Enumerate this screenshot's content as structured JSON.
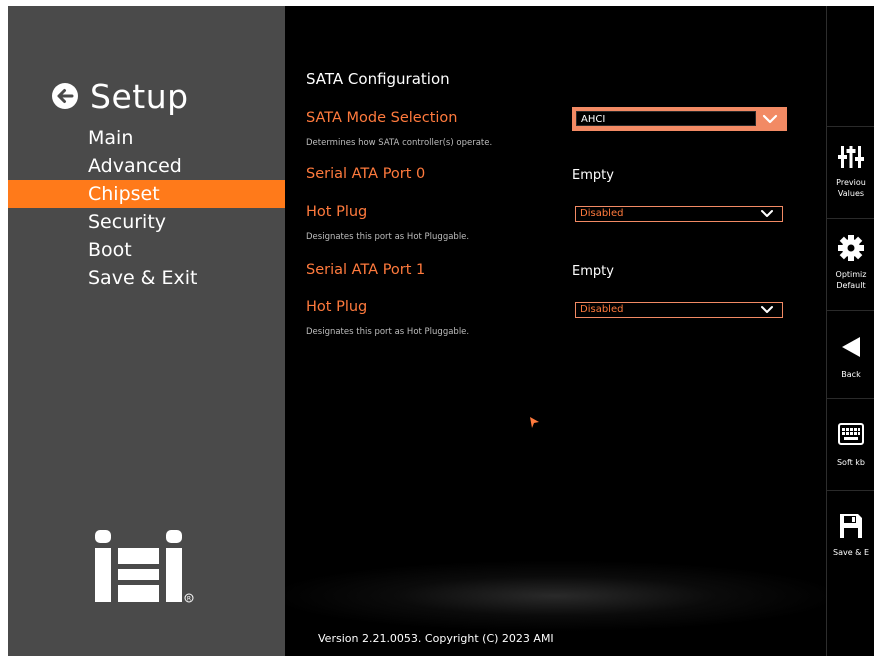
{
  "left_panel": {
    "title": "Setup",
    "menu": [
      {
        "label": "Main"
      },
      {
        "label": "Advanced"
      },
      {
        "label": "Chipset"
      },
      {
        "label": "Security"
      },
      {
        "label": "Boot"
      },
      {
        "label": "Save & Exit"
      }
    ],
    "active_index": 2,
    "logo_text": "iEi"
  },
  "main": {
    "section_title": "SATA Configuration",
    "sata_mode": {
      "label": "SATA Mode Selection",
      "value": "AHCI",
      "help": "Determines how SATA controller(s) operate."
    },
    "port0": {
      "label": "Serial ATA Port 0",
      "value": "Empty"
    },
    "hot_plug_0": {
      "label": "Hot Plug",
      "value": "Disabled",
      "help": "Designates this port as Hot Pluggable."
    },
    "port1": {
      "label": "Serial ATA Port 1",
      "value": "Empty"
    },
    "hot_plug_1": {
      "label": "Hot Plug",
      "value": "Disabled",
      "help": "Designates this port as Hot Pluggable."
    },
    "footer": "Version 2.21.0053. Copyright (C) 2023 AMI"
  },
  "right_panel": {
    "buttons": [
      {
        "label_line1": "Previou",
        "label_line2": "Values",
        "icon": "sliders-icon"
      },
      {
        "label_line1": "Optimiz",
        "label_line2": "Default",
        "icon": "gear-icon"
      },
      {
        "label_line1": "Back",
        "label_line2": "",
        "icon": "back-triangle-icon"
      },
      {
        "label_line1": "Soft kb",
        "label_line2": "",
        "icon": "keyboard-icon"
      },
      {
        "label_line1": "Save & E",
        "label_line2": "",
        "icon": "floppy-icon"
      }
    ]
  },
  "colors": {
    "accent": "#ff7a1a",
    "label_orange": "#ff7a3d",
    "dropdown_border": "#f28a64",
    "left_panel_bg": "#4a4a4a",
    "main_bg": "#000000"
  }
}
